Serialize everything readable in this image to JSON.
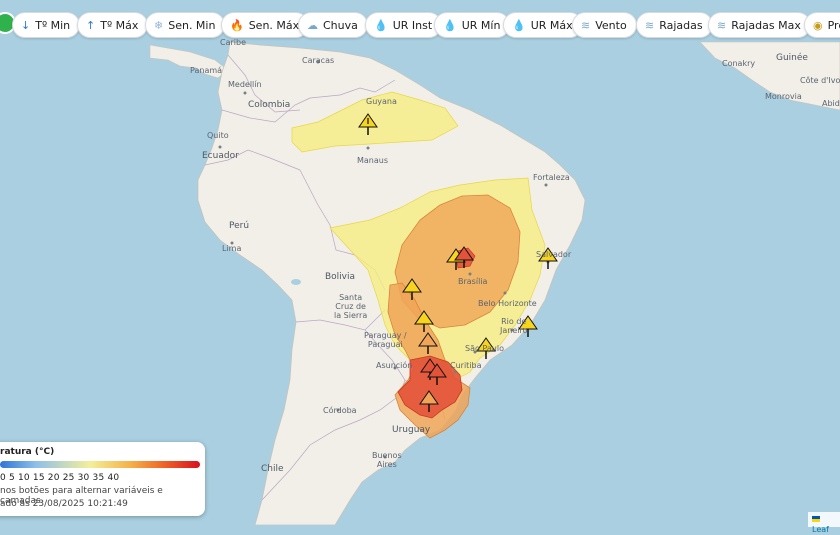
{
  "toolbar": {
    "buttons": [
      {
        "label": "Tº Min",
        "icon": "↓"
      },
      {
        "label": "Tº Máx",
        "icon": "↑"
      },
      {
        "label": "Sen. Min",
        "icon": "❄"
      },
      {
        "label": "Sen. Máx",
        "icon": "🔥"
      },
      {
        "label": "Chuva",
        "icon": "☁"
      },
      {
        "label": "UR Inst",
        "icon": "💧"
      },
      {
        "label": "UR Mín",
        "icon": "💧"
      },
      {
        "label": "UR Máx",
        "icon": "💧"
      },
      {
        "label": "Vento",
        "icon": "≋"
      },
      {
        "label": "Rajadas",
        "icon": "≋"
      },
      {
        "label": "Rajadas Max",
        "icon": "≋"
      },
      {
        "label": "Pre",
        "icon": "◉"
      }
    ]
  },
  "map_labels": {
    "caribe": "Caribe",
    "panama": "Panamá",
    "caracas": "Caracas",
    "medellin": "Medellín",
    "colombia": "Colombia",
    "guyana": "Guyana",
    "quito": "Quito",
    "ecuador": "Ecuador",
    "manaus": "Manaus",
    "fortaleza": "Fortaleza",
    "peru": "Perú",
    "lima": "Lima",
    "bolivia": "Bolivia",
    "santa_cruz": "Santa\nCruz de\nla Sierra",
    "brasilia": "Brasília",
    "salvador": "Salvador",
    "belo_horizonte": "Belo Horizonte",
    "rio": "Rio de\nJaneiro",
    "sao_paulo": "São Paulo",
    "paraguay": "Paraguay /\nParaguai",
    "asuncion": "Asunción",
    "curitiba": "Curitiba",
    "cordoba": "Córdoba",
    "uruguay": "Uruguay",
    "buenos_aires": "Buenos\nAires",
    "chile": "Chile",
    "conakry": "Conakry",
    "guinee": "Guinée",
    "cote": "Côte d'Ivo",
    "monrovia": "Monrovia",
    "abidjan": "Abid"
  },
  "legend": {
    "title": "ratura (°C)",
    "ticks": "0 5 10 15 20 25 30 35 40",
    "hint": "nos botões para alternar variáveis e camadas.",
    "updated": "ado às 23/08/2025 10:21:49",
    "gradient_colors": [
      "#2f74d8",
      "#8fc0e8",
      "#f3ef9a",
      "#f4b24a",
      "#ee6428",
      "#d8101e"
    ]
  },
  "attribution": "Leaf",
  "colors": {
    "ocean": "#a9cfe0",
    "land": "#f2efe9",
    "alert_yellow": "#f7ee7a",
    "alert_orange": "#f0a558",
    "alert_red": "#e3533a",
    "status_green": "#2fb24c"
  },
  "alert_icons": [
    "warning-icon",
    "warning-icon",
    "warning-icon",
    "warning-icon",
    "warning-icon",
    "warning-icon",
    "warning-icon",
    "warning-icon",
    "warning-icon",
    "warning-icon",
    "warning-icon",
    "warning-icon"
  ]
}
